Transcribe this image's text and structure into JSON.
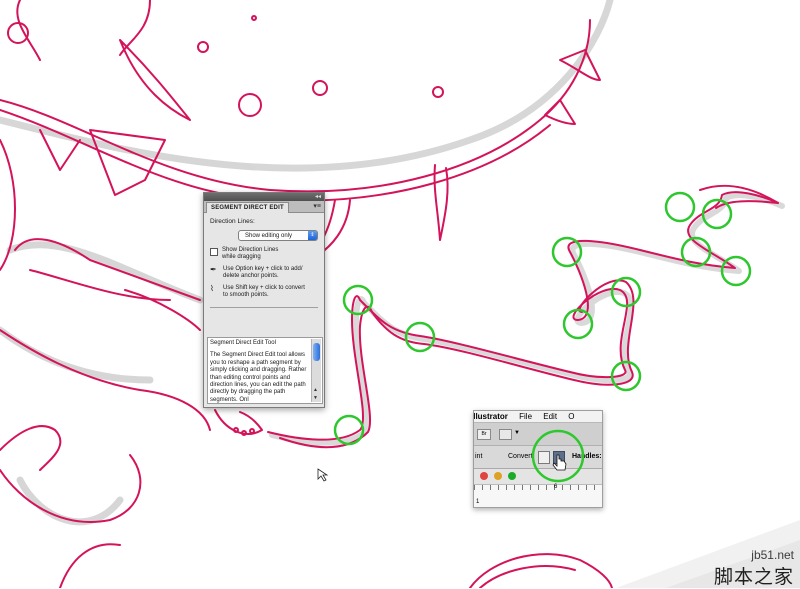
{
  "panel": {
    "tab_title": "SEGMENT DIRECT EDIT",
    "direction_lines_label": "Direction Lines:",
    "direction_lines_value": "Show editing only",
    "show_lines_option_line1": "Show Direction Lines",
    "show_lines_option_line2": "while dragging",
    "option_key_tip_line1": "Use Option key + click to add/",
    "option_key_tip_line2": "delete anchor points.",
    "shift_key_tip_line1": "Use Shift key + click to convert",
    "shift_key_tip_line2": "to smooth points.",
    "help_title": "Segment Direct Edit Tool",
    "help_text": "The Segment Direct Edit tool allows you to reshape a path segment by simply clicking and dragging. Rather than editing control points and direction lines, you can edit the path directly by dragging the path segments. Onl"
  },
  "illustrator_bar": {
    "app_name": "Illustrator",
    "menu_file": "File",
    "menu_edit": "Edit",
    "menu_o": "O",
    "br_button": "Br",
    "int_label": "int",
    "convert_label": "Convert:",
    "handles_label": "Handles:",
    "ruler_mark": "6",
    "ruler_mark_left": "1"
  },
  "watermark": {
    "url": "jb51.net",
    "chinese": "脚本之家"
  },
  "colors": {
    "path_stroke": "#d4145a",
    "shadow": "#c8c8c8",
    "highlight_circle": "#2ec72e"
  }
}
